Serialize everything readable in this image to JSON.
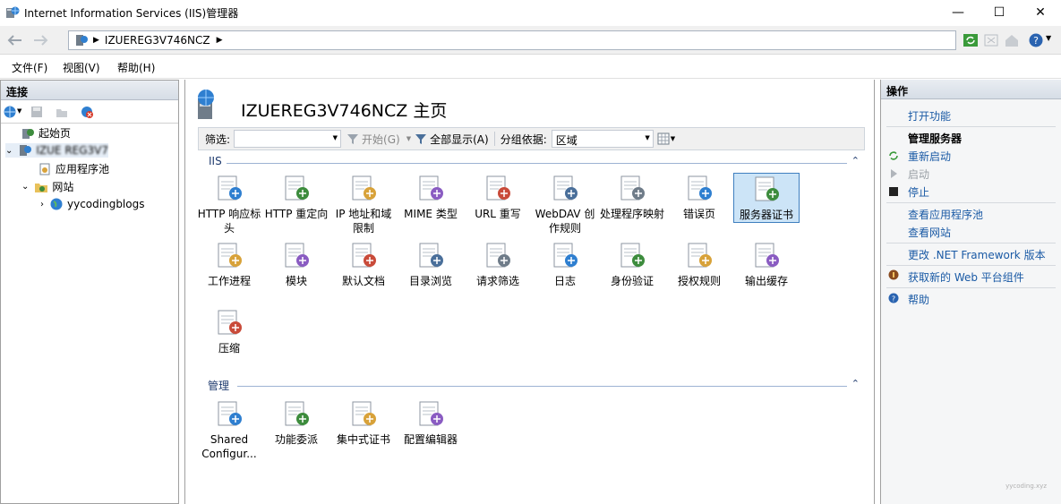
{
  "window": {
    "title": "Internet Information Services (IIS)管理器",
    "minimize": "—",
    "maximize": "☐",
    "close": "✕"
  },
  "address": {
    "path": "IZUEREG3V746NCZ"
  },
  "menu": {
    "file": "文件(F)",
    "view": "视图(V)",
    "help": "帮助(H)"
  },
  "connections": {
    "title": "连接",
    "tree": {
      "start_page": "起始页",
      "server": "IZUE REG3V7",
      "app_pools": "应用程序池",
      "sites": "网站",
      "site1": "yycodingblogs"
    }
  },
  "center": {
    "title": "IZUEREG3V746NCZ 主页",
    "filter": {
      "label": "筛选:",
      "start": "开始(G)",
      "show_all": "全部显示(A)",
      "group_by_label": "分组依据:",
      "group_by_value": "区域"
    },
    "sections": {
      "iis": "IIS",
      "manage": "管理"
    },
    "iis_features": [
      {
        "label": "HTTP 响应标头",
        "icon": "http-response-headers-icon"
      },
      {
        "label": "HTTP 重定向",
        "icon": "http-redirect-icon"
      },
      {
        "label": "IP 地址和域限制",
        "icon": "ip-restrictions-icon"
      },
      {
        "label": "MIME 类型",
        "icon": "mime-types-icon"
      },
      {
        "label": "URL 重写",
        "icon": "url-rewrite-icon"
      },
      {
        "label": "WebDAV 创作规则",
        "icon": "webdav-icon"
      },
      {
        "label": "处理程序映射",
        "icon": "handler-mappings-icon"
      },
      {
        "label": "错误页",
        "icon": "error-pages-icon"
      },
      {
        "label": "服务器证书",
        "icon": "server-certificates-icon"
      },
      {
        "label": "工作进程",
        "icon": "worker-processes-icon"
      },
      {
        "label": "模块",
        "icon": "modules-icon"
      },
      {
        "label": "默认文档",
        "icon": "default-document-icon"
      },
      {
        "label": "目录浏览",
        "icon": "directory-browsing-icon"
      },
      {
        "label": "请求筛选",
        "icon": "request-filtering-icon"
      },
      {
        "label": "日志",
        "icon": "logging-icon"
      },
      {
        "label": "身份验证",
        "icon": "authentication-icon"
      },
      {
        "label": "授权规则",
        "icon": "authorization-rules-icon"
      },
      {
        "label": "输出缓存",
        "icon": "output-caching-icon"
      },
      {
        "label": "压缩",
        "icon": "compression-icon"
      }
    ],
    "manage_features": [
      {
        "label": "Shared Configur...",
        "icon": "shared-config-icon"
      },
      {
        "label": "功能委派",
        "icon": "feature-delegation-icon"
      },
      {
        "label": "集中式证书",
        "icon": "centralized-certs-icon"
      },
      {
        "label": "配置编辑器",
        "icon": "config-editor-icon"
      }
    ]
  },
  "actions": {
    "title": "操作",
    "open_feature": "打开功能",
    "manage_server": "管理服务器",
    "restart": "重新启动",
    "start": "启动",
    "stop": "停止",
    "view_app_pools": "查看应用程序池",
    "view_sites": "查看网站",
    "change_netfx": "更改 .NET Framework 版本",
    "get_web_platform": "获取新的 Web 平台组件",
    "help": "帮助"
  },
  "watermark": "yycoding.xyz",
  "colors": {
    "link": "#1a5aa5",
    "selected_bg": "#cce4f7",
    "section": "#1f3b6e"
  }
}
